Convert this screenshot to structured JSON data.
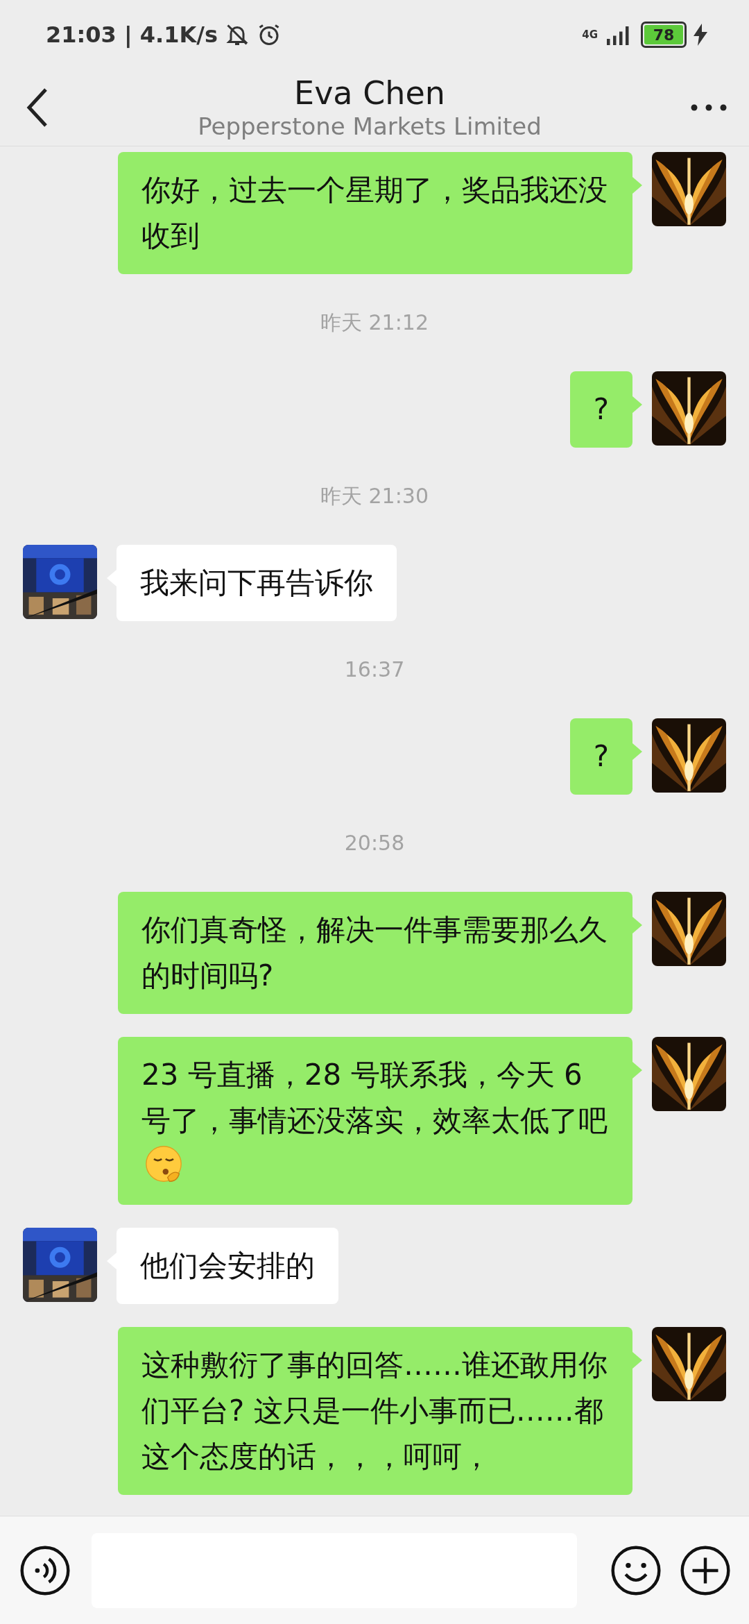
{
  "status_bar": {
    "time": "21:03 | 4.1K/s",
    "network": "4G",
    "battery": "78"
  },
  "header": {
    "title": "Eva Chen",
    "subtitle": "Pepperstone Markets Limited"
  },
  "messages": [
    {
      "kind": "message",
      "outgoing": true,
      "text": "你好，过去一个星期了，奖品我还没收到"
    },
    {
      "kind": "time",
      "text": "昨天 21:12"
    },
    {
      "kind": "message",
      "outgoing": true,
      "text": "?"
    },
    {
      "kind": "time",
      "text": "昨天 21:30"
    },
    {
      "kind": "message",
      "outgoing": false,
      "text": "我来问下再告诉你"
    },
    {
      "kind": "time",
      "text": "16:37"
    },
    {
      "kind": "message",
      "outgoing": true,
      "text": "?"
    },
    {
      "kind": "time",
      "text": "20:58"
    },
    {
      "kind": "message",
      "outgoing": true,
      "text": "你们真奇怪，解决一件事需要那么久的时间吗?"
    },
    {
      "kind": "message",
      "outgoing": true,
      "text": "23 号直播，28 号联系我，今天 6 号了，事情还没落实，效率太低了吧",
      "emoji": true
    },
    {
      "kind": "message",
      "outgoing": false,
      "text": "他们会安排的"
    },
    {
      "kind": "message",
      "outgoing": true,
      "text": "这种敷衍了事的回答……谁还敢用你们平台? 这只是一件小事而已……都这个态度的话，，，呵呵，"
    }
  ]
}
